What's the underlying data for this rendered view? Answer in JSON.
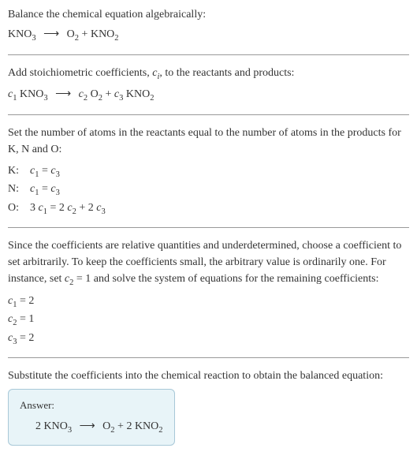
{
  "intro": {
    "text": "Balance the chemical equation algebraically:",
    "reactant": "KNO",
    "reactant_sub": "3",
    "arrow": "⟶",
    "product1": "O",
    "product1_sub": "2",
    "plus": " + ",
    "product2": "KNO",
    "product2_sub": "2"
  },
  "stoich": {
    "text": "Add stoichiometric coefficients, ",
    "ci": "c",
    "ci_sub": "i",
    "text2": ", to the reactants and products:",
    "c1": "c",
    "c1_sub": "1",
    "r1": " KNO",
    "r1_sub": "3",
    "arrow": "⟶",
    "c2": "c",
    "c2_sub": "2",
    "p1": " O",
    "p1_sub": "2",
    "plus": " + ",
    "c3": "c",
    "c3_sub": "3",
    "p2": " KNO",
    "p2_sub": "2"
  },
  "atoms": {
    "text": "Set the number of atoms in the reactants equal to the number of atoms in the products for K, N and O:",
    "rows": [
      {
        "label": "K:",
        "lhs_coeff": "",
        "lhs_c": "c",
        "lhs_sub": "1",
        "eq": " = ",
        "rhs_c": "c",
        "rhs_sub": "3",
        "extra": ""
      },
      {
        "label": "N:",
        "lhs_coeff": "",
        "lhs_c": "c",
        "lhs_sub": "1",
        "eq": " = ",
        "rhs_c": "c",
        "rhs_sub": "3",
        "extra": ""
      },
      {
        "label": "O:",
        "lhs_coeff": "3 ",
        "lhs_c": "c",
        "lhs_sub": "1",
        "eq": " = ",
        "rhs_pre": "2 ",
        "rhs_c": "c",
        "rhs_sub": "2",
        "plus": " + 2 ",
        "rhs2_c": "c",
        "rhs2_sub": "3"
      }
    ]
  },
  "arbitrary": {
    "text1": "Since the coefficients are relative quantities and underdetermined, choose a coefficient to set arbitrarily. To keep the coefficients small, the arbitrary value is ordinarily one. For instance, set ",
    "c": "c",
    "c_sub": "2",
    "text2": " = 1 and solve the system of equations for the remaining coefficients:",
    "coeffs": [
      {
        "c": "c",
        "sub": "1",
        "val": " = 2"
      },
      {
        "c": "c",
        "sub": "2",
        "val": " = 1"
      },
      {
        "c": "c",
        "sub": "3",
        "val": " = 2"
      }
    ]
  },
  "substitute": {
    "text": "Substitute the coefficients into the chemical reaction to obtain the balanced equation:"
  },
  "answer": {
    "label": "Answer:",
    "n1": "2 KNO",
    "n1_sub": "3",
    "arrow": "⟶",
    "n2": "O",
    "n2_sub": "2",
    "plus": " + 2 KNO",
    "n3_sub": "2"
  }
}
